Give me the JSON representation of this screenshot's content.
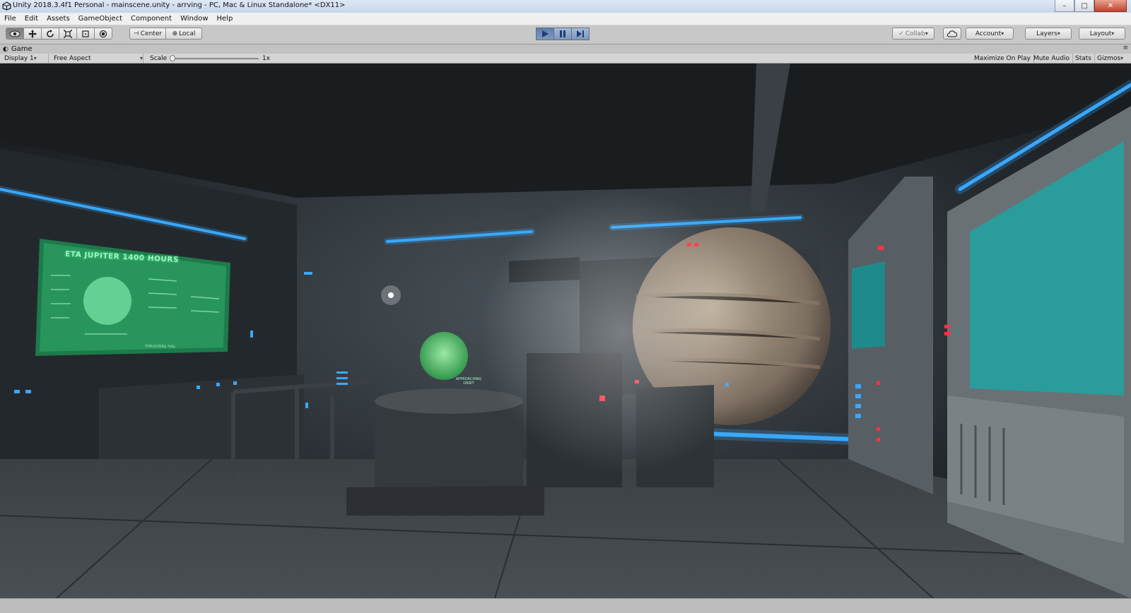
{
  "window": {
    "title": "Unity 2018.3.4f1 Personal - mainscene.unity - arrving - PC, Mac & Linux Standalone* <DX11>",
    "minimize": "–",
    "maximize": "□",
    "close": "✕"
  },
  "menu": [
    "File",
    "Edit",
    "Assets",
    "GameObject",
    "Component",
    "Window",
    "Help"
  ],
  "toolbar": {
    "tools": [
      "hand-tool",
      "move-tool",
      "rotate-tool",
      "scale-tool",
      "rect-tool",
      "transform-tool"
    ],
    "pivot_center": "Center",
    "pivot_local": "Local",
    "collab": "Collab",
    "account": "Account",
    "layers": "Layers",
    "layout": "Layout",
    "play_state": "playing",
    "accent_color": "#4a7cc4"
  },
  "game_tab": {
    "label": "Game",
    "display": "Display 1",
    "aspect": "Free Aspect",
    "scale_label": "Scale",
    "scale_value": "1x",
    "maximize_on_play": "Maximize On Play",
    "mute_audio": "Mute Audio",
    "stats": "Stats",
    "gizmos": "Gizmos"
  },
  "scene": {
    "hud_title": "ETA JUPITER 1400 HOURS",
    "hud_thrusters": "THRUSTERS 70%",
    "hologram_label_1": "APPROACHING",
    "hologram_label_2": "ORBIT",
    "neon_color": "#38a8ff",
    "alert_color": "#ff3344",
    "hud_color": "#2fb86a"
  }
}
